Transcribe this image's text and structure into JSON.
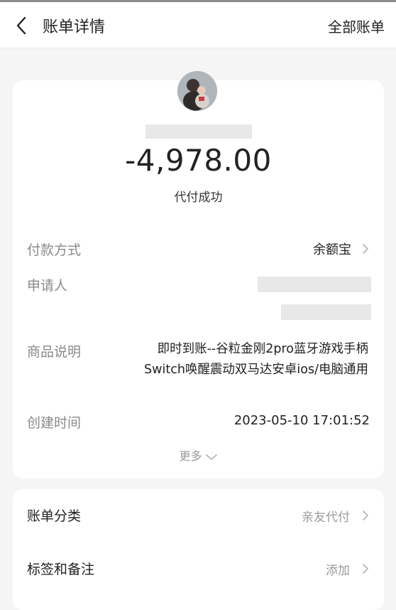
{
  "header": {
    "title": "账单详情",
    "all_bills": "全部账单"
  },
  "summary": {
    "amount": "-4,978.00",
    "status": "代付成功"
  },
  "details": {
    "payment_method_label": "付款方式",
    "payment_method_value": "余额宝",
    "applicant_label": "申请人",
    "product_label": "商品说明",
    "product_line1": "即时到账--谷粒金刚2pro蓝牙游戏手柄",
    "product_line2": "Switch唤醒震动双马达安卓ios/电脑通用",
    "created_label": "创建时间",
    "created_value": "2023-05-10 17:01:52",
    "more": "更多"
  },
  "extra": {
    "category_label": "账单分类",
    "category_value": "亲友代付",
    "tags_label": "标签和备注",
    "tags_value": "添加"
  },
  "icons": [
    "back-arrow-icon",
    "chevron-right-icon",
    "chevron-down-icon"
  ]
}
